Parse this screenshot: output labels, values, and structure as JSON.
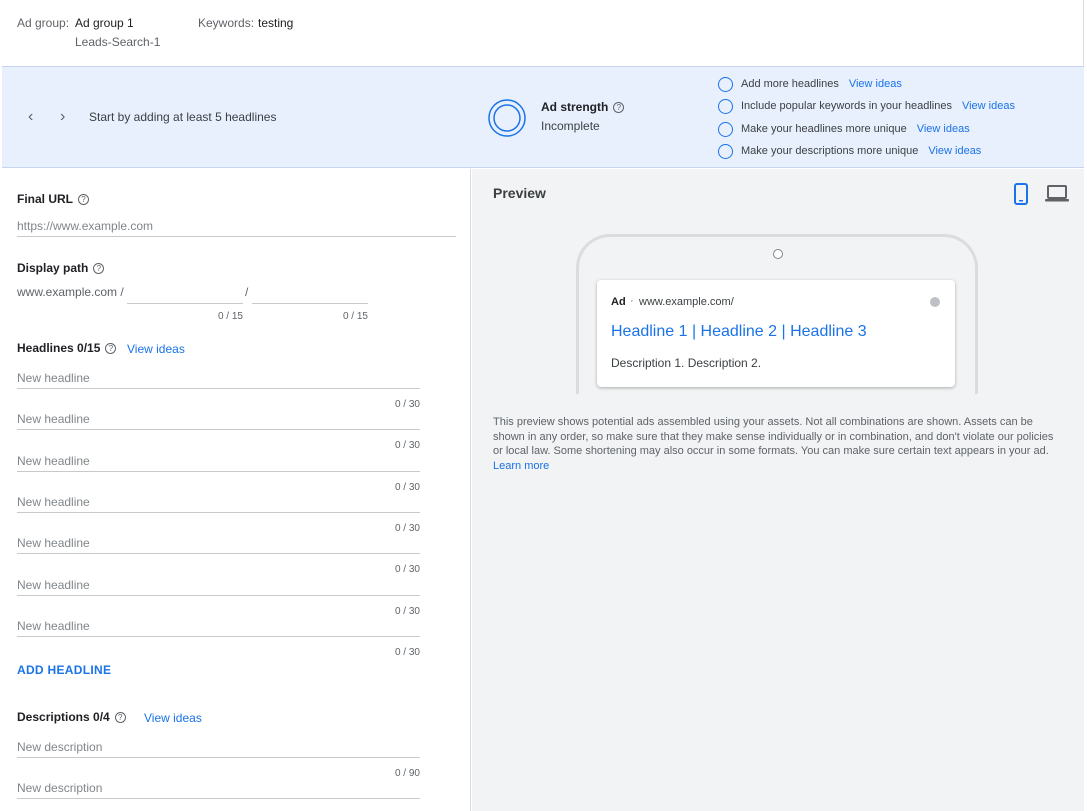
{
  "header": {
    "ad_group_label": "Ad group:",
    "ad_group_name": "Ad group 1",
    "campaign_name": "Leads-Search-1",
    "keywords_label": "Keywords:",
    "keywords_value": "testing"
  },
  "strength": {
    "tip": "Start by adding at least 5 headlines",
    "title": "Ad strength",
    "status": "Incomplete",
    "suggestions": [
      {
        "text": "Add more headlines",
        "link": "View ideas"
      },
      {
        "text": "Include popular keywords in your headlines",
        "link": "View ideas"
      },
      {
        "text": "Make your headlines more unique",
        "link": "View ideas"
      },
      {
        "text": "Make your descriptions more unique",
        "link": "View ideas"
      }
    ]
  },
  "form": {
    "final_url": {
      "label": "Final URL",
      "placeholder": "https://www.example.com"
    },
    "display_path": {
      "label": "Display path",
      "prefix": "www.example.com /",
      "separator": "/",
      "counter1": "0 / 15",
      "counter2": "0 / 15"
    },
    "headlines": {
      "label": "Headlines 0/15",
      "view_ideas": "View ideas",
      "items": [
        {
          "placeholder": "New headline",
          "counter": "0 / 30"
        },
        {
          "placeholder": "New headline",
          "counter": "0 / 30"
        },
        {
          "placeholder": "New headline",
          "counter": "0 / 30"
        },
        {
          "placeholder": "New headline",
          "counter": "0 / 30"
        },
        {
          "placeholder": "New headline",
          "counter": "0 / 30"
        },
        {
          "placeholder": "New headline",
          "counter": "0 / 30"
        },
        {
          "placeholder": "New headline",
          "counter": "0 / 30"
        }
      ],
      "add_label": "ADD HEADLINE"
    },
    "descriptions": {
      "label": "Descriptions 0/4",
      "view_ideas": "View ideas",
      "items": [
        {
          "placeholder": "New description",
          "counter": "0 / 90"
        },
        {
          "placeholder": "New description",
          "counter": ""
        }
      ]
    }
  },
  "preview": {
    "title": "Preview",
    "device_icons": [
      "mobile-icon",
      "laptop-icon"
    ],
    "ad": {
      "badge": "Ad",
      "separator": "·",
      "url": "www.example.com/",
      "headline": "Headline 1 | Headline 2 | Headline 3",
      "description": "Description 1. Description 2."
    },
    "disclaimer": "This preview shows potential ads assembled using your assets. Not all combinations are shown. Assets can be shown in any order, so make sure that they make sense individually or in combination, and don't violate our policies or local law. Some shortening may also occur in some formats. You can make sure certain text appears in your ad.",
    "learn_more": "Learn more"
  },
  "colors": {
    "accent": "#1a73e8",
    "band": "#e8f0fe",
    "preview_bg": "#f1f3f4"
  }
}
